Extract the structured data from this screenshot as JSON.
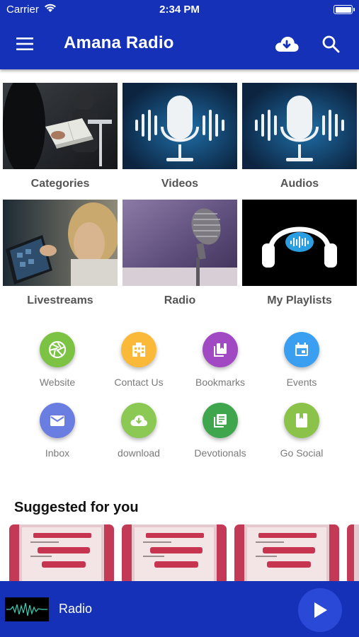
{
  "status_bar": {
    "carrier": "Carrier",
    "time": "2:34 PM"
  },
  "app_bar": {
    "title": "Amana Radio",
    "icons": [
      "menu-icon",
      "cloud-download-icon",
      "search-icon"
    ]
  },
  "tiles": [
    {
      "label": "Categories"
    },
    {
      "label": "Videos"
    },
    {
      "label": "Audios"
    },
    {
      "label": "Livestreams"
    },
    {
      "label": "Radio"
    },
    {
      "label": "My Playlists"
    }
  ],
  "shortcuts": [
    {
      "label": "Website",
      "color": "#7cc243",
      "icon": "aperture-icon"
    },
    {
      "label": "Contact Us",
      "color": "#fbb93a",
      "icon": "building-icon"
    },
    {
      "label": "Bookmarks",
      "color": "#a149c2",
      "icon": "bookmarks-icon"
    },
    {
      "label": "Events",
      "color": "#3a9ff0",
      "icon": "calendar-icon"
    },
    {
      "label": "Inbox",
      "color": "#6a7de0",
      "icon": "mail-icon"
    },
    {
      "label": "download",
      "color": "#8cc854",
      "icon": "cloud-download-icon"
    },
    {
      "label": "Devotionals",
      "color": "#3fa64d",
      "icon": "library-books-icon"
    },
    {
      "label": "Go Social",
      "color": "#8bc34a",
      "icon": "book-icon"
    }
  ],
  "suggested": {
    "title": "Suggested for you"
  },
  "player": {
    "title": "Radio"
  },
  "colors": {
    "primary": "#1531b8",
    "play_button": "#2a49d6"
  }
}
